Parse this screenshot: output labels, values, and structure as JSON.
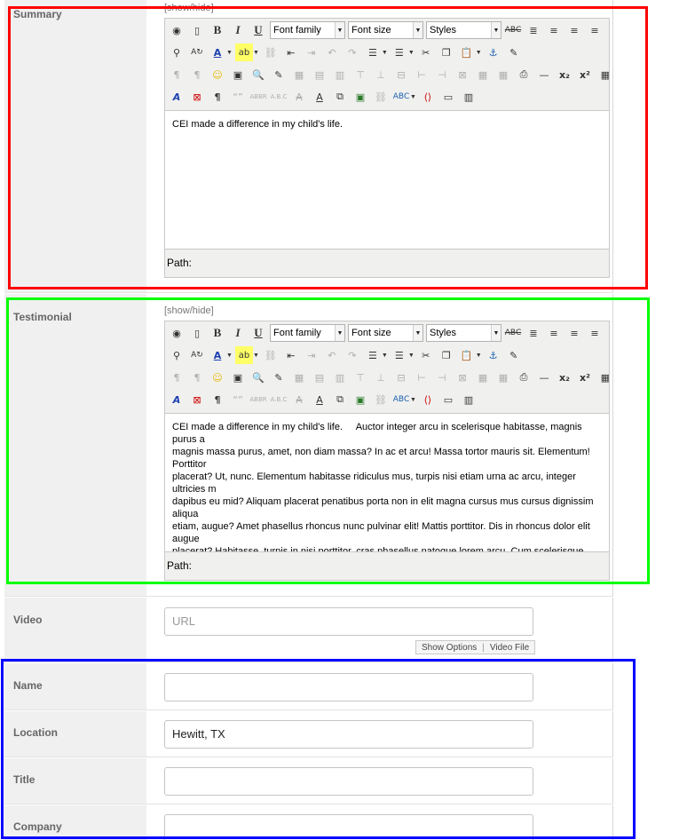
{
  "summary": {
    "label": "Summary",
    "toggle": "[show/hide]",
    "font_family": "Font family",
    "font_size": "Font size",
    "styles": "Styles",
    "content": "CEI made a difference in my child's life.",
    "path_label": "Path:"
  },
  "testimonial": {
    "label": "Testimonial",
    "toggle": "[show/hide]",
    "font_family": "Font family",
    "font_size": "Font size",
    "styles": "Styles",
    "content": "CEI made a difference in my child's life.     Auctor integer arcu in scelerisque habitasse, magnis purus a\nmagnis massa purus, amet, non diam massa? In ac et arcu! Massa tortor mauris sit. Elementum! Porttitor\nplacerat? Ut, nunc. Elementum habitasse ridiculus mus, turpis nisi etiam urna ac arcu, integer ultricies m\ndapibus eu mid? Aliquam placerat penatibus porta non in elit magna cursus mus cursus dignissim aliqua\netiam, augue? Amet phasellus rhoncus nunc pulvinar elit! Mattis porttitor. Dis in rhoncus dolor elit augue\nplacerat? Habitasse, turpis in nisi porttitor, cras phasellus natoque lorem arcu. Cum scelerisque quis na\nsociis amet magna rhoncus in duis turpis! Cum magnis? Nisi, placerat pulvinar platea integer ultricies. A\nelementum nunc porttitor ut est. Massa pulvinar dignissim, duis.",
    "path_label": "Path:"
  },
  "video": {
    "label": "Video",
    "placeholder": "URL",
    "show_options": "Show Options",
    "separator": "|",
    "video_file": "Video File"
  },
  "name": {
    "label": "Name",
    "value": ""
  },
  "location": {
    "label": "Location",
    "value": "Hewitt, TX"
  },
  "title": {
    "label": "Title",
    "value": ""
  },
  "company": {
    "label": "Company",
    "value": ""
  },
  "annotation_colors": {
    "summary": "#ff0000",
    "testimonial": "#00ff00",
    "contact": "#0000ff"
  }
}
